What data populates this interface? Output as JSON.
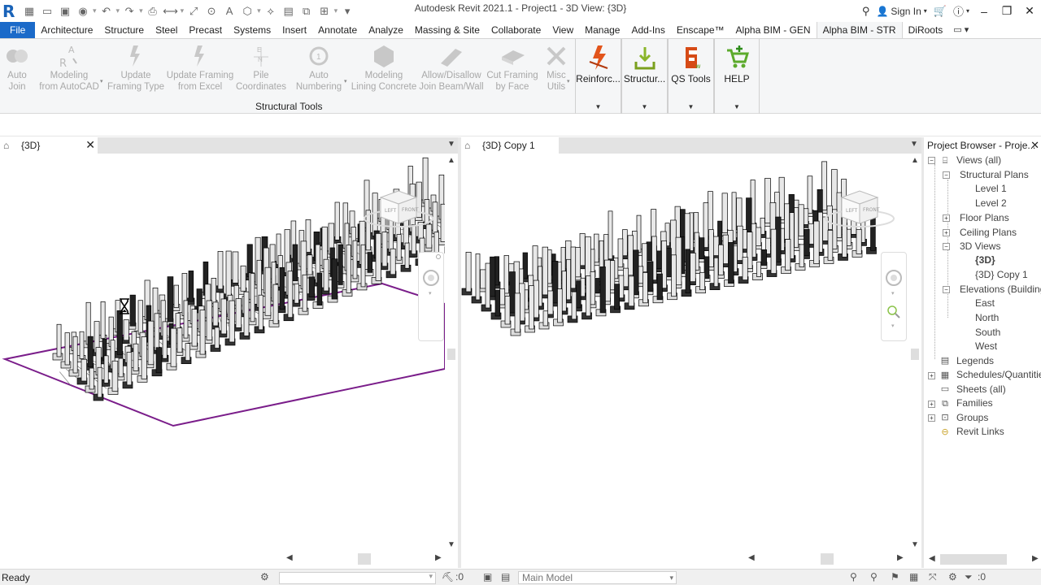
{
  "window": {
    "title": "Autodesk Revit 2021.1 - Project1 - 3D View: {3D}",
    "sign_in": "Sign In"
  },
  "ribbon": {
    "tabs": [
      "File",
      "Architecture",
      "Structure",
      "Steel",
      "Precast",
      "Systems",
      "Insert",
      "Annotate",
      "Analyze",
      "Massing & Site",
      "Collaborate",
      "View",
      "Manage",
      "Add-Ins",
      "Enscape™",
      "Alpha BIM - GEN",
      "Alpha BIM - STR",
      "DiRoots"
    ],
    "active_tab": "Alpha BIM - STR",
    "tools": [
      {
        "line1": "Auto",
        "line2": "Join"
      },
      {
        "line1": "Modeling",
        "line2": "from AutoCAD"
      },
      {
        "line1": "Update",
        "line2": "Framing Type"
      },
      {
        "line1": "Update Framing",
        "line2": "from Excel"
      },
      {
        "line1": "Pile",
        "line2": "Coordinates"
      },
      {
        "line1": "Auto",
        "line2": "Numbering"
      },
      {
        "line1": "Modeling",
        "line2": "Lining Concrete"
      },
      {
        "line1": "Allow/Disallow",
        "line2": "Join Beam/Wall"
      },
      {
        "line1": "Cut Framing",
        "line2": "by Face"
      },
      {
        "line1": "Misc",
        "line2": "Utils"
      }
    ],
    "panel_label": "Structural Tools",
    "groups": [
      {
        "label": "Reinforc..."
      },
      {
        "label": "Structur..."
      },
      {
        "label": "QS Tools"
      },
      {
        "label": "HELP"
      }
    ],
    "colors": {
      "file_tab": "#1b6ac9",
      "reinforc_icon": "#e2541b",
      "structur_icon": "#8ab52a",
      "qs_icon": "#d64b16",
      "help_icon": "#5caa2c"
    }
  },
  "views": {
    "left_tab": "{3D}",
    "right_tab": "{3D} Copy 1"
  },
  "project_browser": {
    "title": "Project Browser - Proje...",
    "items": [
      {
        "label": "Views (all)"
      },
      {
        "label": "Structural Plans"
      },
      {
        "label": "Level 1"
      },
      {
        "label": "Level 2"
      },
      {
        "label": "Floor Plans"
      },
      {
        "label": "Ceiling Plans"
      },
      {
        "label": "3D Views"
      },
      {
        "label": "{3D}"
      },
      {
        "label": "{3D} Copy 1"
      },
      {
        "label": "Elevations (Building"
      },
      {
        "label": "East"
      },
      {
        "label": "North"
      },
      {
        "label": "South"
      },
      {
        "label": "West"
      },
      {
        "label": "Legends"
      },
      {
        "label": "Schedules/Quantities"
      },
      {
        "label": "Sheets (all)"
      },
      {
        "label": "Families"
      },
      {
        "label": "Groups"
      },
      {
        "label": "Revit Links"
      }
    ]
  },
  "viewcube": {
    "left_face": "LEFT",
    "front_face": "FRONT"
  },
  "status": {
    "text": "Ready",
    "count_a": ":0",
    "model": "Main Model",
    "filter_count": ":0"
  }
}
